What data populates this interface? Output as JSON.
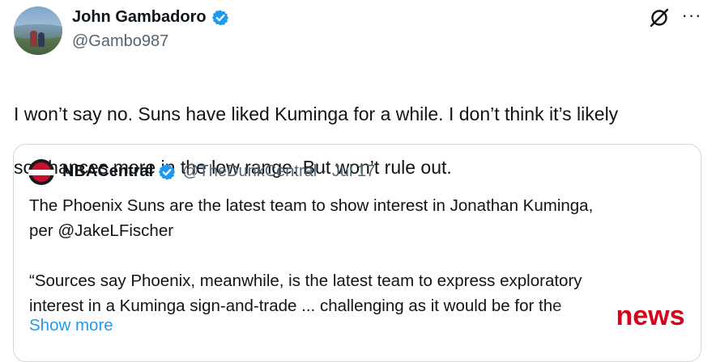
{
  "author": {
    "display_name": "John Gambadoro",
    "handle": "@Gambo987",
    "verified": true
  },
  "header_icons": [
    "grok-icon",
    "more-icon"
  ],
  "more_glyph": "···",
  "tweet": {
    "text_line1": "I won’t say no. Suns have liked Kuminga for a while. I don’t think it’s likely",
    "text_line2": "so chances more in the low range. But won’t rule out."
  },
  "quote": {
    "display_name": "NBACentral",
    "verified": true,
    "handle": "@TheDunkCentral",
    "separator": "·",
    "date": "Jul 17",
    "para1_line1": "The Phoenix Suns are the latest team to show interest in Jonathan Kuminga,",
    "para1_line2": "per @JakeLFischer",
    "para2_line1": "“Sources say Phoenix, meanwhile, is the latest team to express exploratory",
    "para2_line2": "interest in a Kuminga sign-and-trade ... challenging as it would be for the",
    "show_more": "Show more"
  },
  "watermark": {
    "text": "news",
    "color": "#d3041b"
  },
  "colors": {
    "verified_blue": "#1d9bf0",
    "link_blue": "#1d9bf0",
    "secondary_text": "#536471",
    "border": "#cfd9de"
  }
}
